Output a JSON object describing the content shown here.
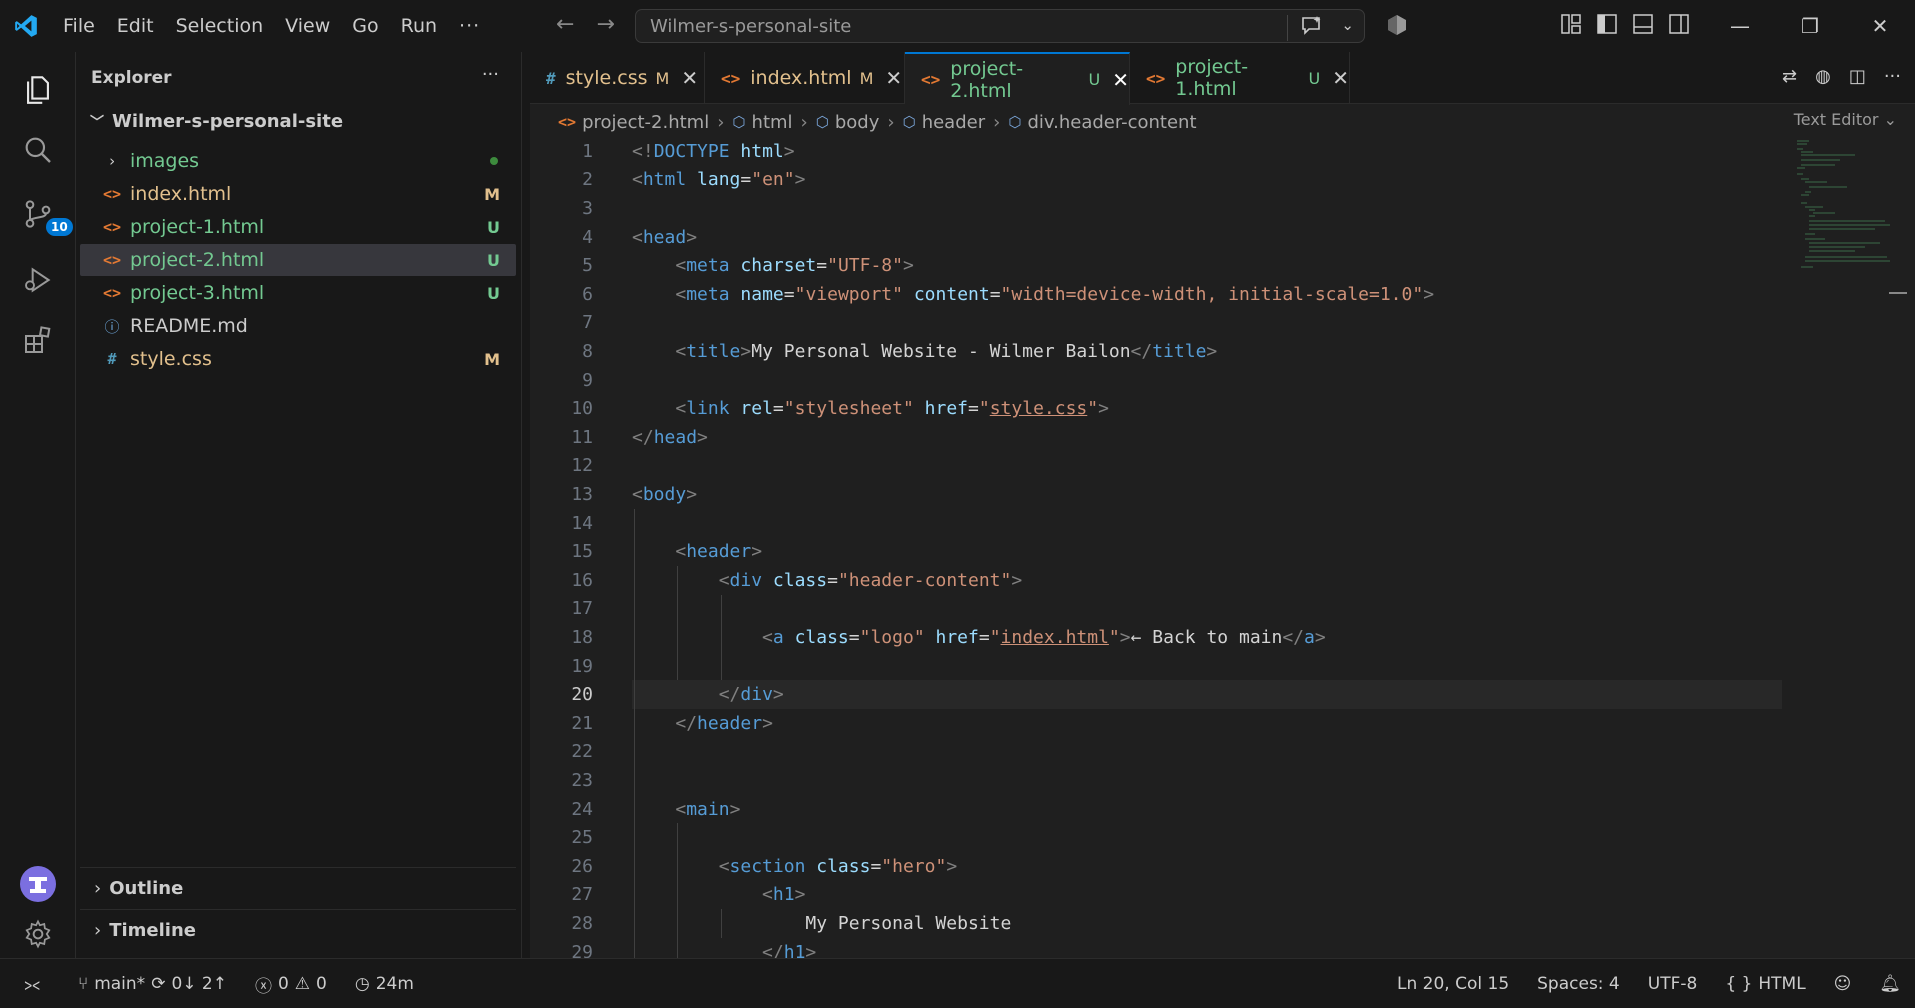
{
  "menu": [
    "File",
    "Edit",
    "Selection",
    "View",
    "Go",
    "Run",
    "···"
  ],
  "search": {
    "text": "Wilmer-s-personal-site"
  },
  "explorer": {
    "title": "Explorer",
    "folder": "Wilmer-s-personal-site",
    "items": [
      {
        "name": "images",
        "type": "folder",
        "status": "",
        "color": "#73c991"
      },
      {
        "name": "index.html",
        "type": "html",
        "status": "M",
        "color": "#e2c08d"
      },
      {
        "name": "project-1.html",
        "type": "html",
        "status": "U",
        "color": "#73c991"
      },
      {
        "name": "project-2.html",
        "type": "html",
        "status": "U",
        "color": "#73c991"
      },
      {
        "name": "project-3.html",
        "type": "html",
        "status": "U",
        "color": "#73c991"
      },
      {
        "name": "README.md",
        "type": "info",
        "status": "",
        "color": "#cccccc"
      },
      {
        "name": "style.css",
        "type": "css",
        "status": "M",
        "color": "#e2c08d"
      }
    ],
    "outline": "Outline",
    "timeline": "Timeline"
  },
  "activity": {
    "scm_badge": "10"
  },
  "tabs": [
    {
      "label": "style.css",
      "status": "M",
      "icon": "#",
      "color": "#e2c08d",
      "active": false
    },
    {
      "label": "index.html",
      "status": "M",
      "icon": "<>",
      "color": "#e2c08d",
      "active": false
    },
    {
      "label": "project-2.html",
      "status": "U",
      "icon": "<>",
      "color": "#73c991",
      "active": true
    },
    {
      "label": "project-1.html",
      "status": "U",
      "icon": "<>",
      "color": "#73c991",
      "active": false
    }
  ],
  "breadcrumb": [
    "project-2.html",
    "html",
    "body",
    "header",
    "div.header-content"
  ],
  "text_editor_label": "Text Editor",
  "code_lines": [
    "<!DOCTYPE html>",
    "<html lang=\"en\">",
    "",
    "<head>",
    "    <meta charset=\"UTF-8\">",
    "    <meta name=\"viewport\" content=\"width=device-width, initial-scale=1.0\">",
    "",
    "    <title>My Personal Website - Wilmer Bailon</title>",
    "",
    "    <link rel=\"stylesheet\" href=\"style.css\">",
    "</head>",
    "",
    "<body>",
    "",
    "    <header>",
    "        <div class=\"header-content\">",
    "",
    "            <a class=\"logo\" href=\"index.html\">← Back to main</a>",
    "",
    "        </div>",
    "    </header>",
    "",
    "",
    "    <main>",
    "",
    "        <section class=\"hero\">",
    "            <h1>",
    "                My Personal Website",
    "            </h1>"
  ],
  "current_line": 20,
  "status": {
    "branch": "main*",
    "sync": "0↓ 2↑",
    "errors": "0",
    "warnings": "0",
    "time": "24m",
    "position": "Ln 20, Col 15",
    "spaces": "Spaces: 4",
    "encoding": "UTF-8",
    "language": "HTML"
  }
}
